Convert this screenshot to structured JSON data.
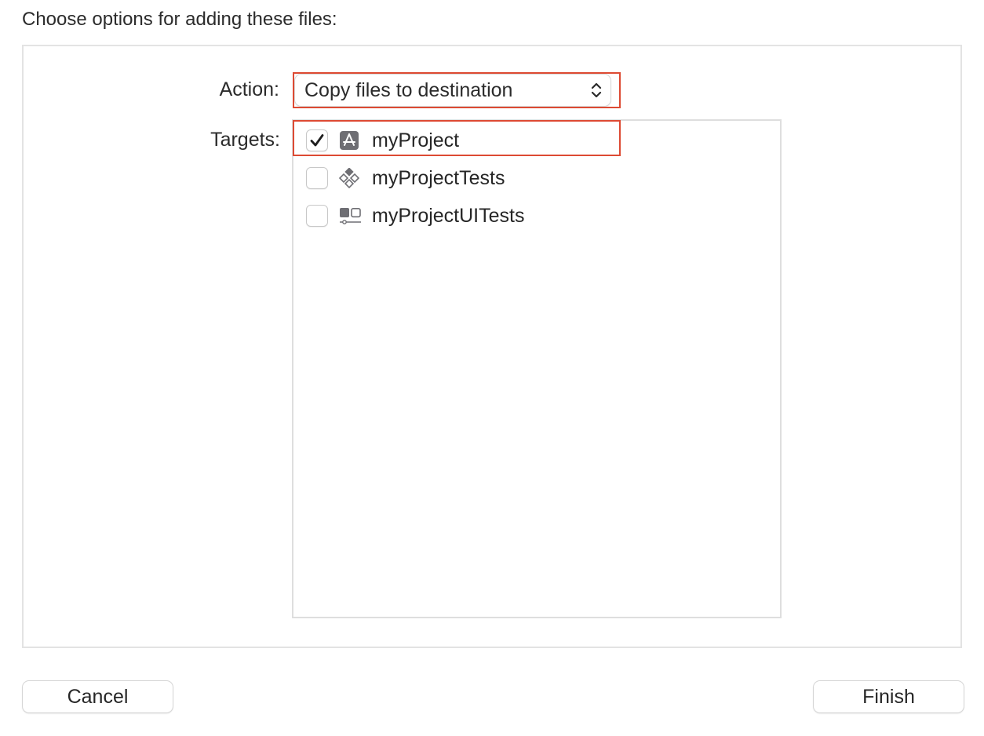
{
  "dialog": {
    "heading": "Choose options for adding these files:"
  },
  "action": {
    "label": "Action:",
    "value": "Copy files to destination"
  },
  "targets": {
    "label": "Targets:",
    "items": [
      {
        "name": "myProject",
        "checked": true,
        "icon": "app-target-icon"
      },
      {
        "name": "myProjectTests",
        "checked": false,
        "icon": "unit-test-target-icon"
      },
      {
        "name": "myProjectUITests",
        "checked": false,
        "icon": "ui-test-target-icon"
      }
    ]
  },
  "buttons": {
    "cancel": "Cancel",
    "finish": "Finish"
  },
  "colors": {
    "highlight": "#dd4a33",
    "icon": "#6e6e73"
  }
}
